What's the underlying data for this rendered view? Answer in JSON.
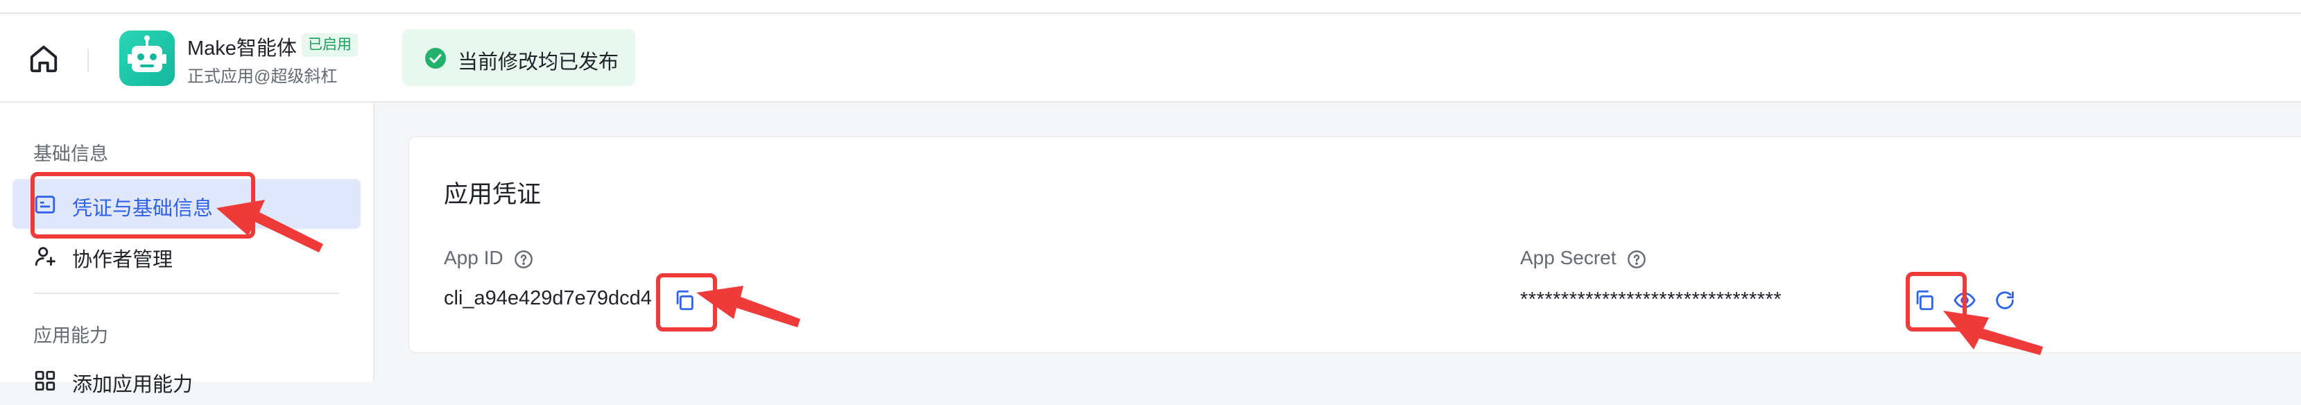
{
  "header": {
    "app_name": "Make智能体",
    "badge": "已启用",
    "app_subtitle": "正式应用@超级斜杠",
    "publish_status": "当前修改均已发布"
  },
  "sidebar": {
    "section_basic": "基础信息",
    "items_basic": [
      {
        "label": "凭证与基础信息",
        "icon": "credential-icon",
        "active": true
      },
      {
        "label": "协作者管理",
        "icon": "user-add-icon",
        "active": false
      }
    ],
    "section_capability": "应用能力",
    "items_capability": [
      {
        "label": "添加应用能力",
        "icon": "grid-icon"
      }
    ]
  },
  "credentials": {
    "title": "应用凭证",
    "app_id_label": "App ID",
    "app_id_value": "cli_a94e429d7e79dcd4",
    "app_secret_label": "App Secret",
    "app_secret_value": "********************************"
  },
  "colors": {
    "accent": "#2f62ea",
    "success_bg": "#e8f8ee",
    "success": "#1a9e5c",
    "annotation": "#ef3a3a"
  }
}
